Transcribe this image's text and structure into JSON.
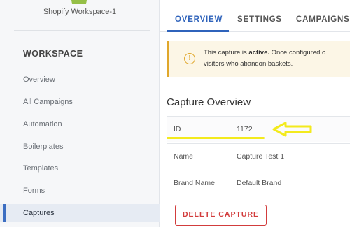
{
  "sidebar": {
    "workspace_name": "Shopify Workspace-1",
    "heading": "WORKSPACE",
    "items": [
      {
        "label": "Overview"
      },
      {
        "label": "All Campaigns"
      },
      {
        "label": "Automation"
      },
      {
        "label": "Boilerplates"
      },
      {
        "label": "Templates"
      },
      {
        "label": "Forms"
      },
      {
        "label": "Captures",
        "active": true
      }
    ]
  },
  "tabs": [
    {
      "label": "OVERVIEW",
      "active": true
    },
    {
      "label": "SETTINGS"
    },
    {
      "label": "CAMPAIGNS"
    }
  ],
  "notice": {
    "icon": "info-icon",
    "line1_prefix": "This capture is ",
    "line1_bold": "active.",
    "line1_suffix": " Once configured o",
    "line2": "visitors who abandon baskets."
  },
  "capture_overview": {
    "title": "Capture Overview",
    "rows": [
      {
        "label": "ID",
        "value": "1172"
      },
      {
        "label": "Name",
        "value": "Capture Test 1"
      },
      {
        "label": "Brand Name",
        "value": "Default Brand"
      }
    ]
  },
  "delete_button_label": "DELETE CAPTURE",
  "colors": {
    "accent": "#2f63bb",
    "warning": "#e0a72b",
    "danger": "#d23c3c",
    "annotation": "#f3ea1d"
  }
}
